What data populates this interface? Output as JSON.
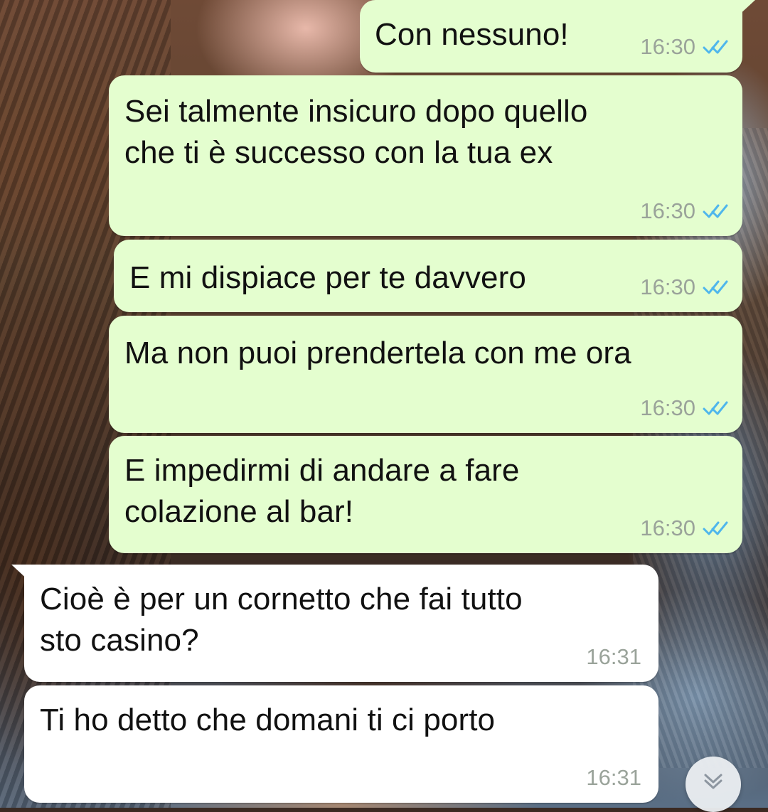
{
  "messages": [
    {
      "direction": "outgoing",
      "text": "Con nessuno!",
      "time": "16:30",
      "status_icon": "double-check-read-icon"
    },
    {
      "direction": "outgoing",
      "text": "Sei talmente insicuro dopo quello\nche ti è successo con la tua ex",
      "time": "16:30",
      "status_icon": "double-check-read-icon"
    },
    {
      "direction": "outgoing",
      "text": "E mi dispiace per te davvero",
      "time": "16:30",
      "status_icon": "double-check-read-icon"
    },
    {
      "direction": "outgoing",
      "text": "Ma non puoi prendertela con me ora",
      "time": "16:30",
      "status_icon": "double-check-read-icon"
    },
    {
      "direction": "outgoing",
      "text": "E impedirmi di andare a fare\ncolazione al bar!",
      "time": "16:30",
      "status_icon": "double-check-read-icon"
    },
    {
      "direction": "incoming",
      "text": "Cioè è per un cornetto che fai tutto\nsto casino?",
      "time": "16:31"
    },
    {
      "direction": "incoming",
      "text": "Ti ho detto che domani ti ci porto",
      "time": "16:31"
    }
  ],
  "colors": {
    "outgoing_bubble": "#e4fecf",
    "incoming_bubble": "#ffffff",
    "read_ticks": "#4fb6ec",
    "timestamp": "#9aa39a"
  },
  "controls": {
    "scroll_down_icon": "chevron-double-down-icon"
  }
}
